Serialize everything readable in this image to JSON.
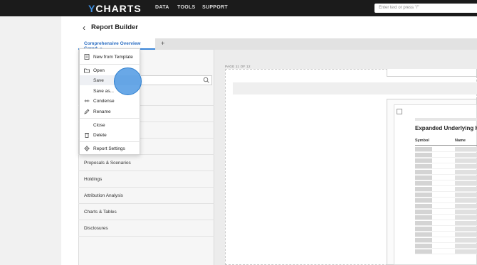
{
  "app": {
    "logo": "YCHARTS",
    "nav": [
      "DATA",
      "TOOLS",
      "SUPPORT"
    ],
    "search_placeholder": "Enter text or press \"/\""
  },
  "page": {
    "back_icon": "chevron-left-icon",
    "title": "Report Builder"
  },
  "tabs": {
    "active_label": "Comprehensive Overview Copy*",
    "add_label": "+"
  },
  "menu": {
    "items": [
      {
        "label": "New from Template",
        "icon": "template-icon"
      },
      {
        "label": "Open",
        "icon": "folder-icon"
      },
      {
        "label": "Save",
        "icon": "none",
        "active": true
      },
      {
        "label": "Save as...",
        "icon": "none"
      },
      {
        "label": "Condense",
        "icon": "condense-icon"
      },
      {
        "label": "Rename",
        "icon": "pencil-icon"
      },
      {
        "label": "Close",
        "icon": "none"
      },
      {
        "label": "Delete",
        "icon": "trash-icon"
      },
      {
        "label": "Report Settings",
        "icon": "gear-icon"
      }
    ]
  },
  "sidebar": {
    "sections": [
      "Proposals & Scenarios",
      "Holdings",
      "Attribution Analysis",
      "Charts & Tables",
      "Disclosures"
    ]
  },
  "canvas": {
    "page_label": "PAGE 11 OF 12",
    "card_title": "Expanded Underlying Ho",
    "columns": [
      "Symbol",
      "Name"
    ]
  },
  "colors": {
    "accent": "#3a86d9",
    "topbar": "#1b1b1b",
    "cursor": "#3f8fe0"
  }
}
